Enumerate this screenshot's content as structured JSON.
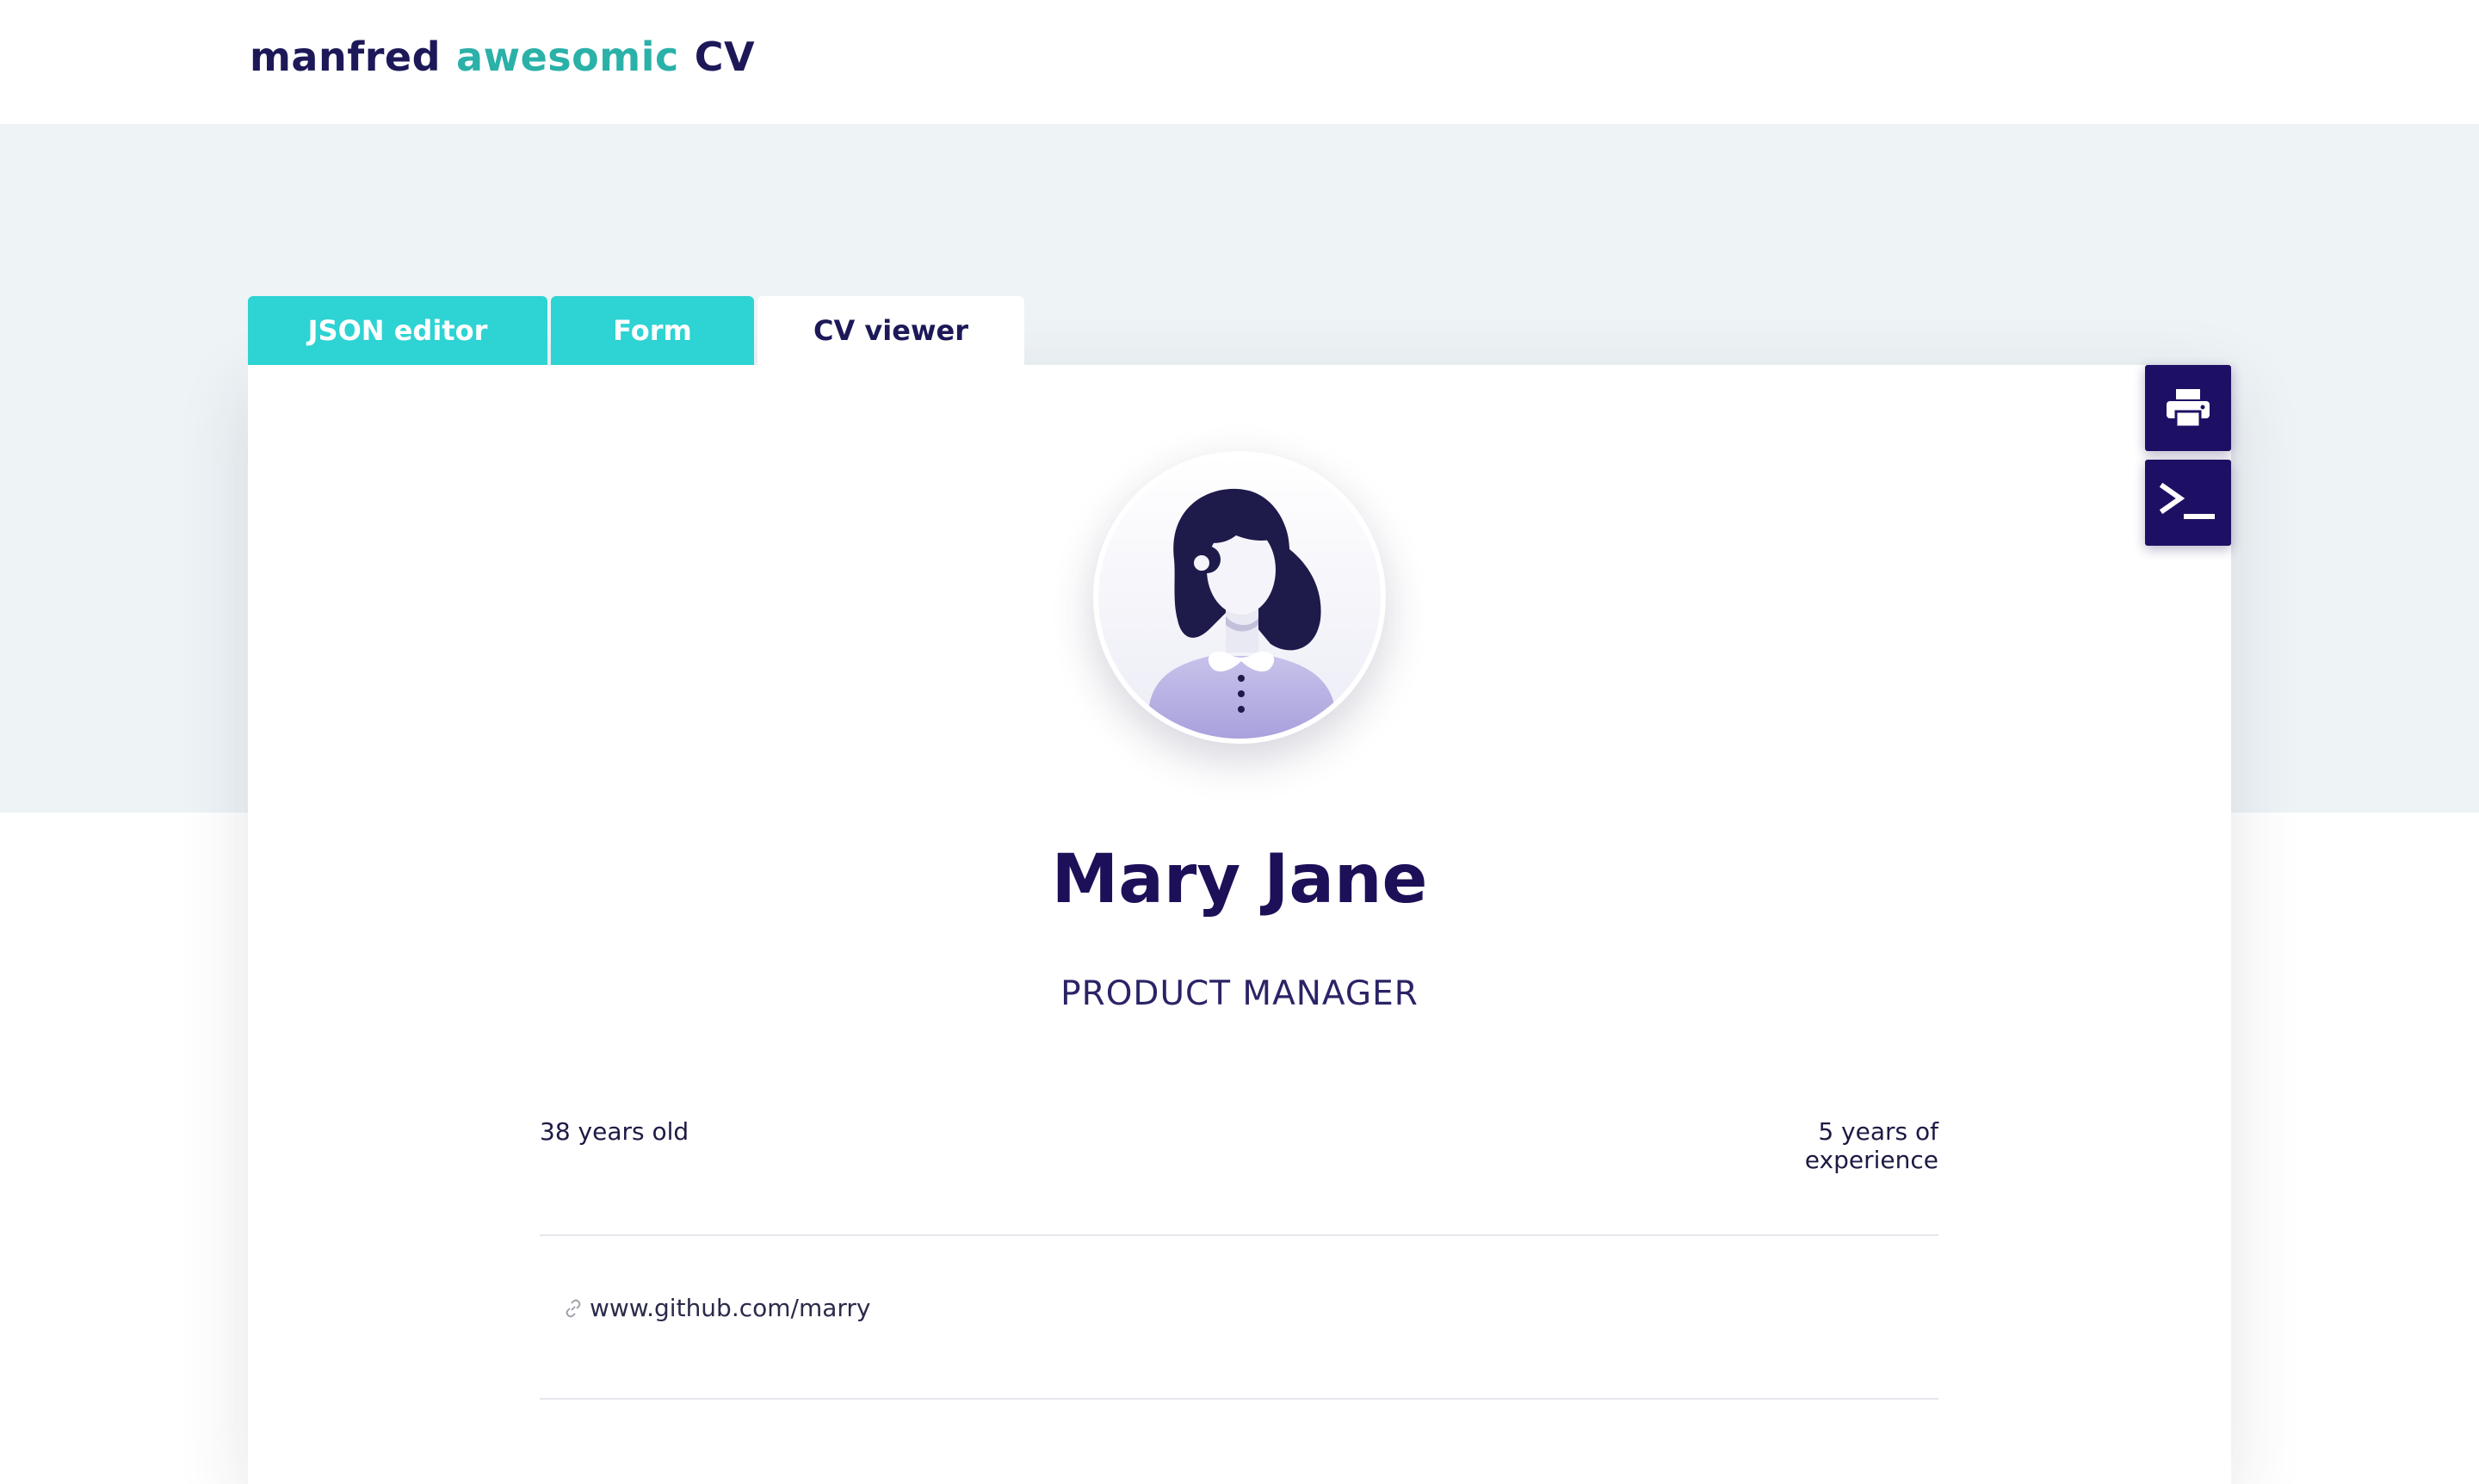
{
  "header": {
    "logo_part1": "manfred",
    "logo_part2": "awesomic",
    "logo_part3": "CV"
  },
  "tabs": [
    {
      "label": "JSON editor",
      "active": false
    },
    {
      "label": "Form",
      "active": false
    },
    {
      "label": "CV viewer",
      "active": true
    }
  ],
  "actions": {
    "print_icon": "printer-icon",
    "terminal_icon": "terminal-icon"
  },
  "profile": {
    "name": "Mary Jane",
    "title": "PRODUCT MANAGER",
    "age": "38 years old",
    "experience": "5 years of experience",
    "link": "www.github.com/marry",
    "link_icon": "link-icon"
  },
  "colors": {
    "brand_dark": "#1d1064",
    "brand_teal": "#2ed3d3",
    "band_bg": "#eef3f6"
  }
}
